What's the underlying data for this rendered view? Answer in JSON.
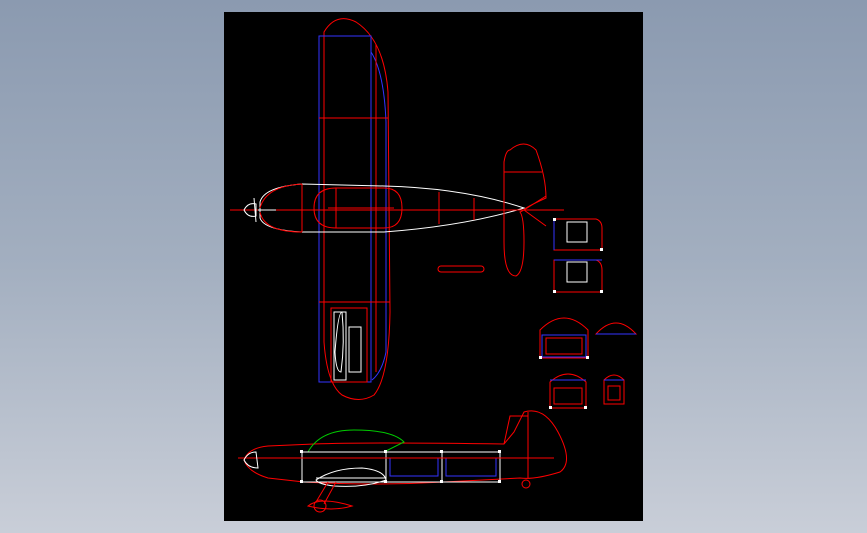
{
  "viewer": {
    "background": "#000000",
    "page_background_top": "#8b9ab0",
    "page_background_bottom": "#c9ced8"
  },
  "drawing": {
    "colors": {
      "outline": "#ff0000",
      "structure": "#3333ff",
      "canopy": "#00cc00",
      "detail": "#ffffff"
    },
    "views": [
      "top-view",
      "side-view",
      "stabilizer-parts",
      "former-parts"
    ]
  }
}
